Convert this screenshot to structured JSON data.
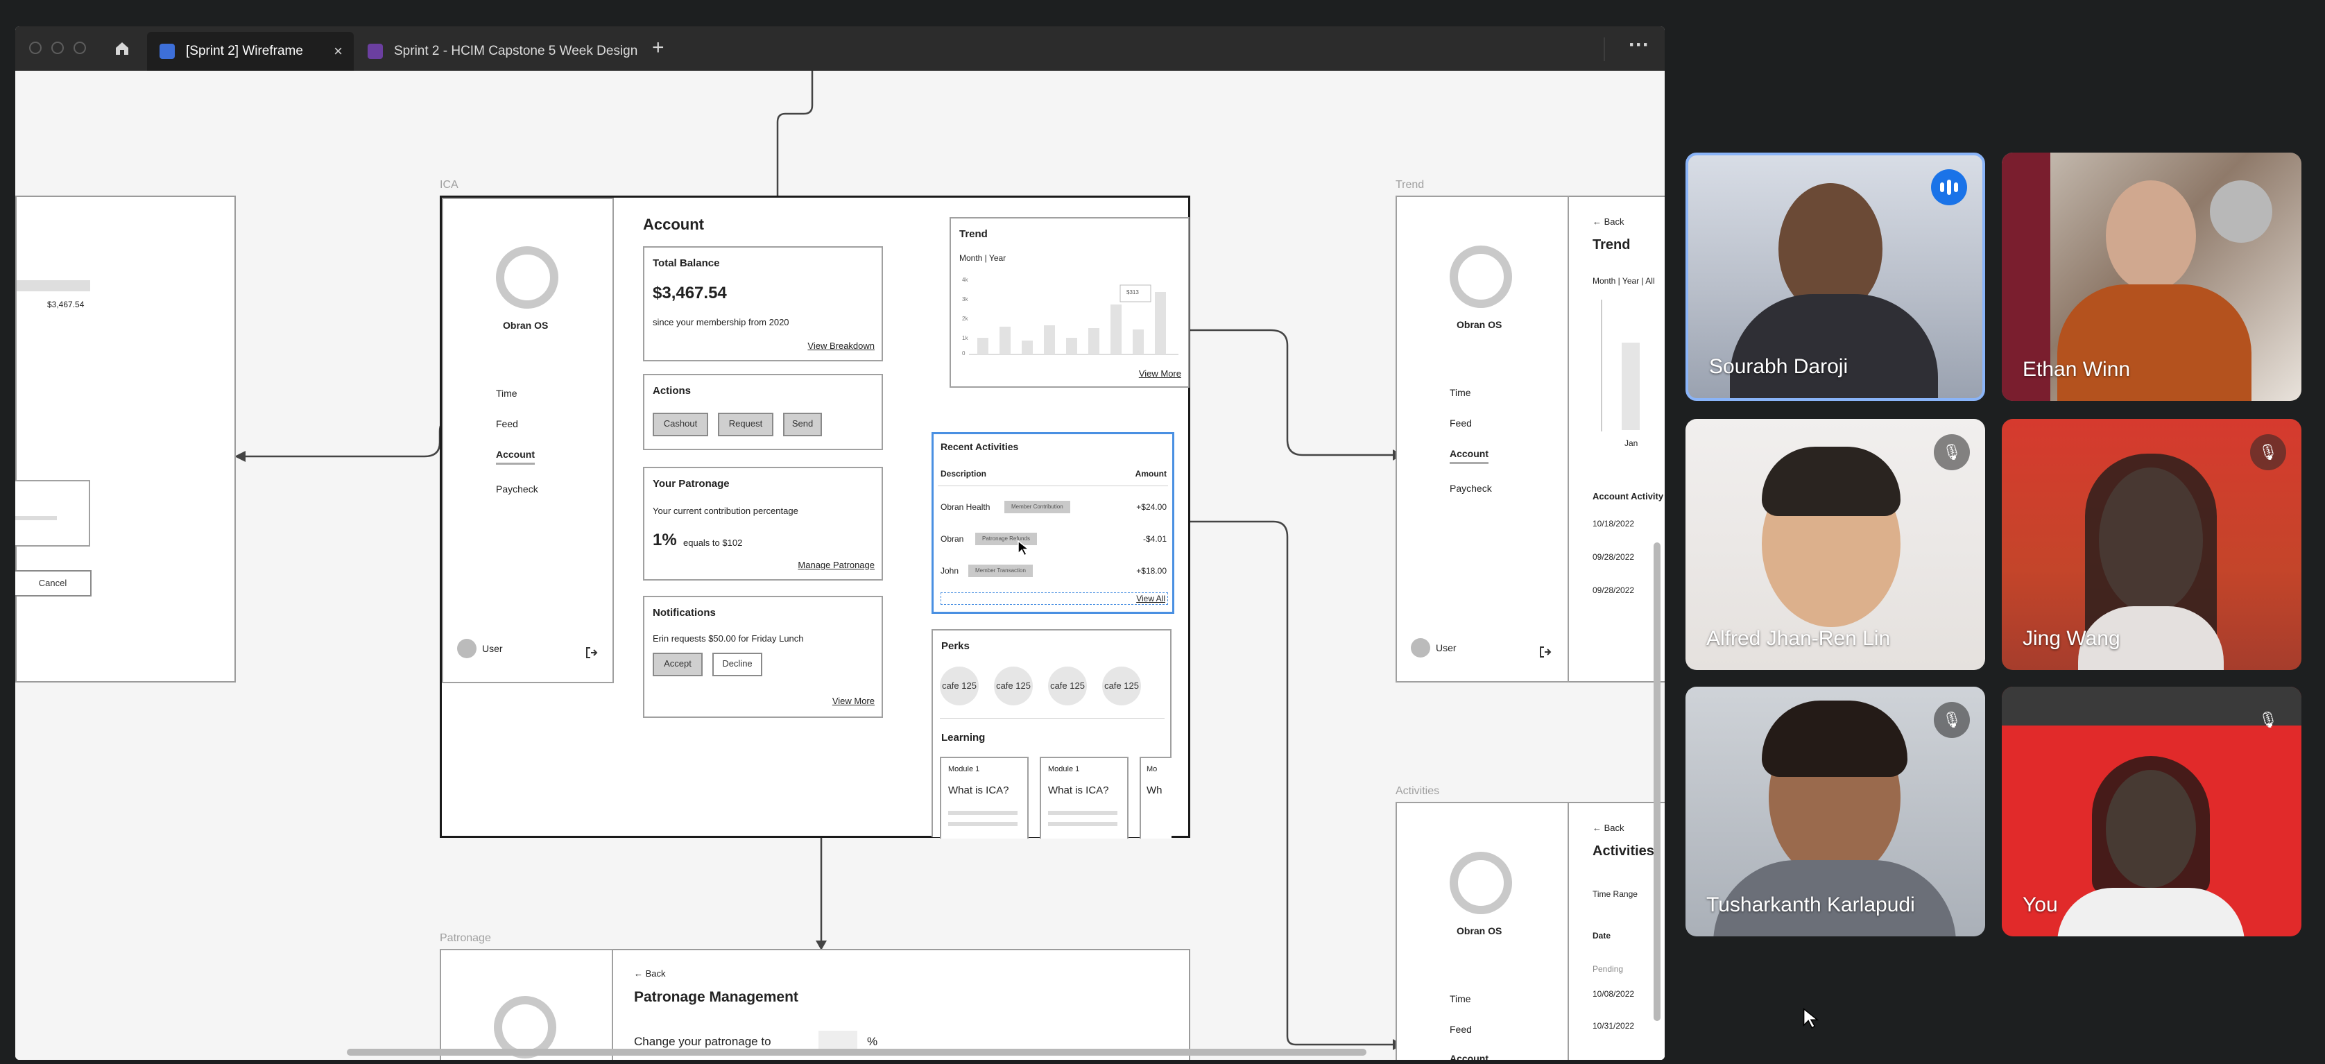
{
  "figma": {
    "tabs": [
      {
        "label": "[Sprint 2] Wireframe"
      },
      {
        "label": "Sprint 2 - HCIM Capstone 5 Week Design"
      }
    ],
    "add_tab": "+",
    "more": "···",
    "close": "×"
  },
  "canvas": {
    "left_frame": {
      "amount": "$3,467.54",
      "cancel": "Cancel"
    },
    "ica": {
      "label": "ICA",
      "brand": "Obran OS",
      "nav": [
        "Time",
        "Feed",
        "Account",
        "Paycheck"
      ],
      "user": "User",
      "title": "Account",
      "balance": {
        "title": "Total Balance",
        "amount": "$3,467.54",
        "since": "since your membership from 2020",
        "link": "View Breakdown"
      },
      "actions": {
        "title": "Actions",
        "buttons": [
          "Cashout",
          "Request",
          "Send"
        ]
      },
      "patronage": {
        "title": "Your Patronage",
        "desc": "Your current contribution percentage",
        "pct": "1%",
        "equals": "equals to $102",
        "link": "Manage Patronage"
      },
      "notifications": {
        "title": "Notifications",
        "msg": "Erin requests $50.00 for Friday Lunch",
        "accept": "Accept",
        "decline": "Decline",
        "link": "View More"
      },
      "trend": {
        "title": "Trend",
        "toggle": "Month | Year",
        "link": "View More",
        "tooltip": "$313",
        "yticks": [
          "4k",
          "3k",
          "2k",
          "1k",
          "0"
        ]
      },
      "recent": {
        "title": "Recent Activities",
        "col_desc": "Description",
        "col_amount": "Amount",
        "rows": [
          {
            "name": "Obran Health",
            "tag": "Member Contribution",
            "amount": "+$24.00"
          },
          {
            "name": "Obran",
            "tag": "Patronage Refunds",
            "amount": "-$4.01"
          },
          {
            "name": "John",
            "tag": "Member Transaction",
            "amount": "+$18.00"
          }
        ],
        "link": "View All"
      },
      "perks": {
        "title": "Perks",
        "items": [
          "cafe 125",
          "cafe 125",
          "cafe 125",
          "cafe 125"
        ]
      },
      "learning": {
        "title": "Learning",
        "cards": [
          {
            "module": "Module 1",
            "title": "What is ICA?"
          },
          {
            "module": "Module 1",
            "title": "What is ICA?"
          },
          {
            "module": "Mo",
            "title": "Wh"
          }
        ]
      }
    },
    "trend_frame": {
      "label": "Trend",
      "brand": "Obran OS",
      "nav": [
        "Time",
        "Feed",
        "Account",
        "Paycheck"
      ],
      "user": "User",
      "back": "Back",
      "title": "Trend",
      "toggle": "Month | Year | All",
      "xtick": "Jan",
      "section": "Account Activity",
      "dates": [
        "10/18/2022",
        "09/28/2022",
        "09/28/2022"
      ]
    },
    "activities_frame": {
      "label": "Activities",
      "brand": "Obran OS",
      "nav": [
        "Time",
        "Feed",
        "Account"
      ],
      "back": "Back",
      "title": "Activities",
      "time_range": "Time Range",
      "date": "Date",
      "pending": "Pending",
      "dates": [
        "10/08/2022",
        "10/31/2022"
      ]
    },
    "patronage_frame": {
      "label": "Patronage",
      "back": "Back",
      "title": "Patronage Management",
      "change": "Change your patronage to",
      "pct": "%"
    }
  },
  "meet": {
    "participants": [
      {
        "name": "Sourabh Daroji",
        "speaking": true
      },
      {
        "name": "Ethan Winn",
        "muted": false
      },
      {
        "name": "Alfred Jhan-Ren Lin",
        "muted": true
      },
      {
        "name": "Jing Wang",
        "muted": true
      },
      {
        "name": "Tusharkanth Karlapudi",
        "muted": true
      },
      {
        "name": "You",
        "muted": true
      }
    ]
  },
  "colors": {
    "selection": "#4a90e2",
    "meet_speaking": "#8ab4f8",
    "background": "#1d1f20"
  }
}
